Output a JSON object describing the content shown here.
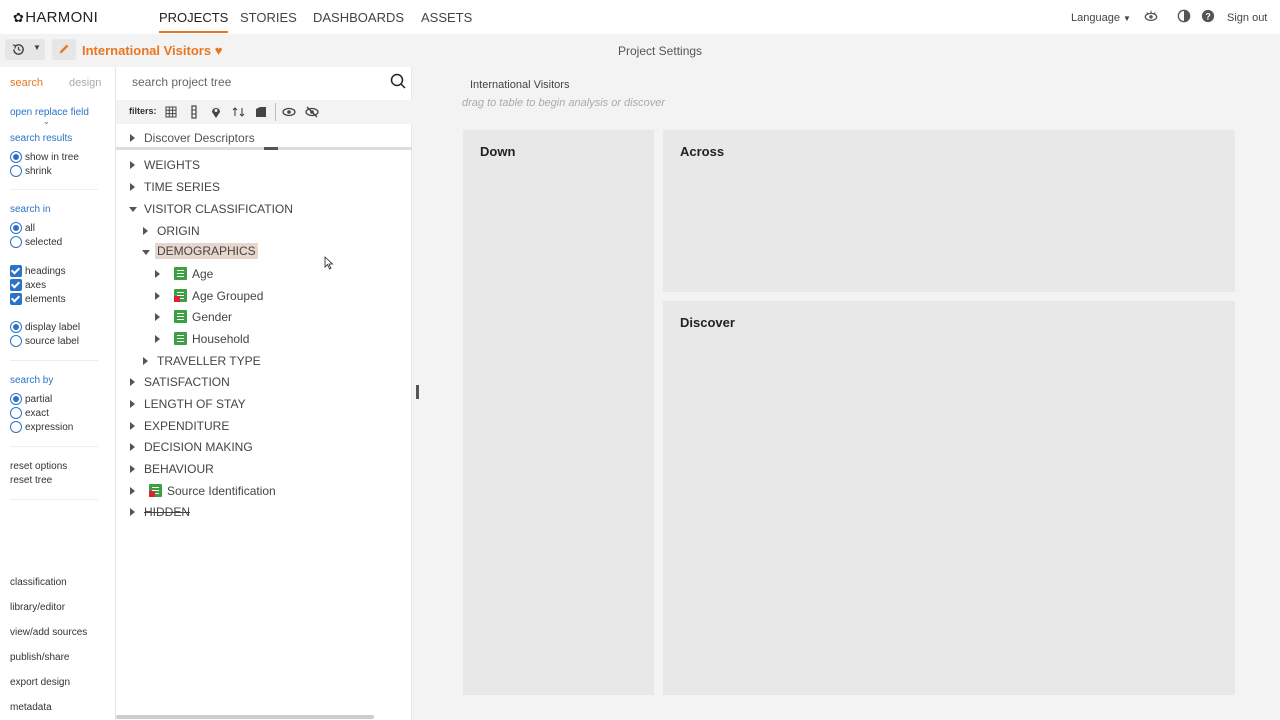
{
  "brand": {
    "name": "HARMONI"
  },
  "nav": {
    "items": [
      {
        "label": "PROJECTS",
        "active": true
      },
      {
        "label": "STORIES",
        "active": false
      },
      {
        "label": "DASHBOARDS",
        "active": false
      },
      {
        "label": "ASSETS",
        "active": false
      }
    ],
    "language": "Language",
    "signout": "Sign out"
  },
  "project": {
    "title": "International Visitors",
    "settings": "Project Settings"
  },
  "rail": {
    "tabs": {
      "search": "search",
      "design": "design"
    },
    "open_replace": "open replace field",
    "results_heading": "search results",
    "results_opts": [
      "show in tree",
      "shrink"
    ],
    "search_in_heading": "search in",
    "search_in_opts": [
      "all",
      "selected"
    ],
    "checks": [
      "headings",
      "axes",
      "elements"
    ],
    "label_opts": [
      "display label",
      "source label"
    ],
    "search_by_heading": "search by",
    "search_by_opts": [
      "partial",
      "exact",
      "expression"
    ],
    "reset_options": "reset options",
    "reset_tree": "reset tree",
    "footer": [
      "classification",
      "library/editor",
      "view/add sources",
      "publish/share",
      "export design",
      "metadata"
    ]
  },
  "tree": {
    "search_placeholder": "search project tree",
    "filters_label": "filters:",
    "discover": "Discover Descriptors",
    "rows": [
      {
        "label": "WEIGHTS"
      },
      {
        "label": "TIME SERIES"
      },
      {
        "label": "VISITOR CLASSIFICATION"
      },
      {
        "label": "ORIGIN"
      },
      {
        "label": "DEMOGRAPHICS"
      },
      {
        "label": "Age"
      },
      {
        "label": "Age Grouped"
      },
      {
        "label": "Gender"
      },
      {
        "label": "Household"
      },
      {
        "label": "TRAVELLER TYPE"
      },
      {
        "label": "SATISFACTION"
      },
      {
        "label": "LENGTH OF STAY"
      },
      {
        "label": "EXPENDITURE"
      },
      {
        "label": "DECISION MAKING"
      },
      {
        "label": "BEHAVIOUR"
      },
      {
        "label": "Source Identification"
      },
      {
        "label": "HIDDEN"
      }
    ]
  },
  "workspace": {
    "crumb": "International Visitors",
    "hint": "drag to table to begin analysis or discover",
    "down": "Down",
    "across": "Across",
    "discover": "Discover"
  },
  "colors": {
    "accent": "#e87722",
    "link": "#2a73c8",
    "element_icon": "#3aa043"
  }
}
